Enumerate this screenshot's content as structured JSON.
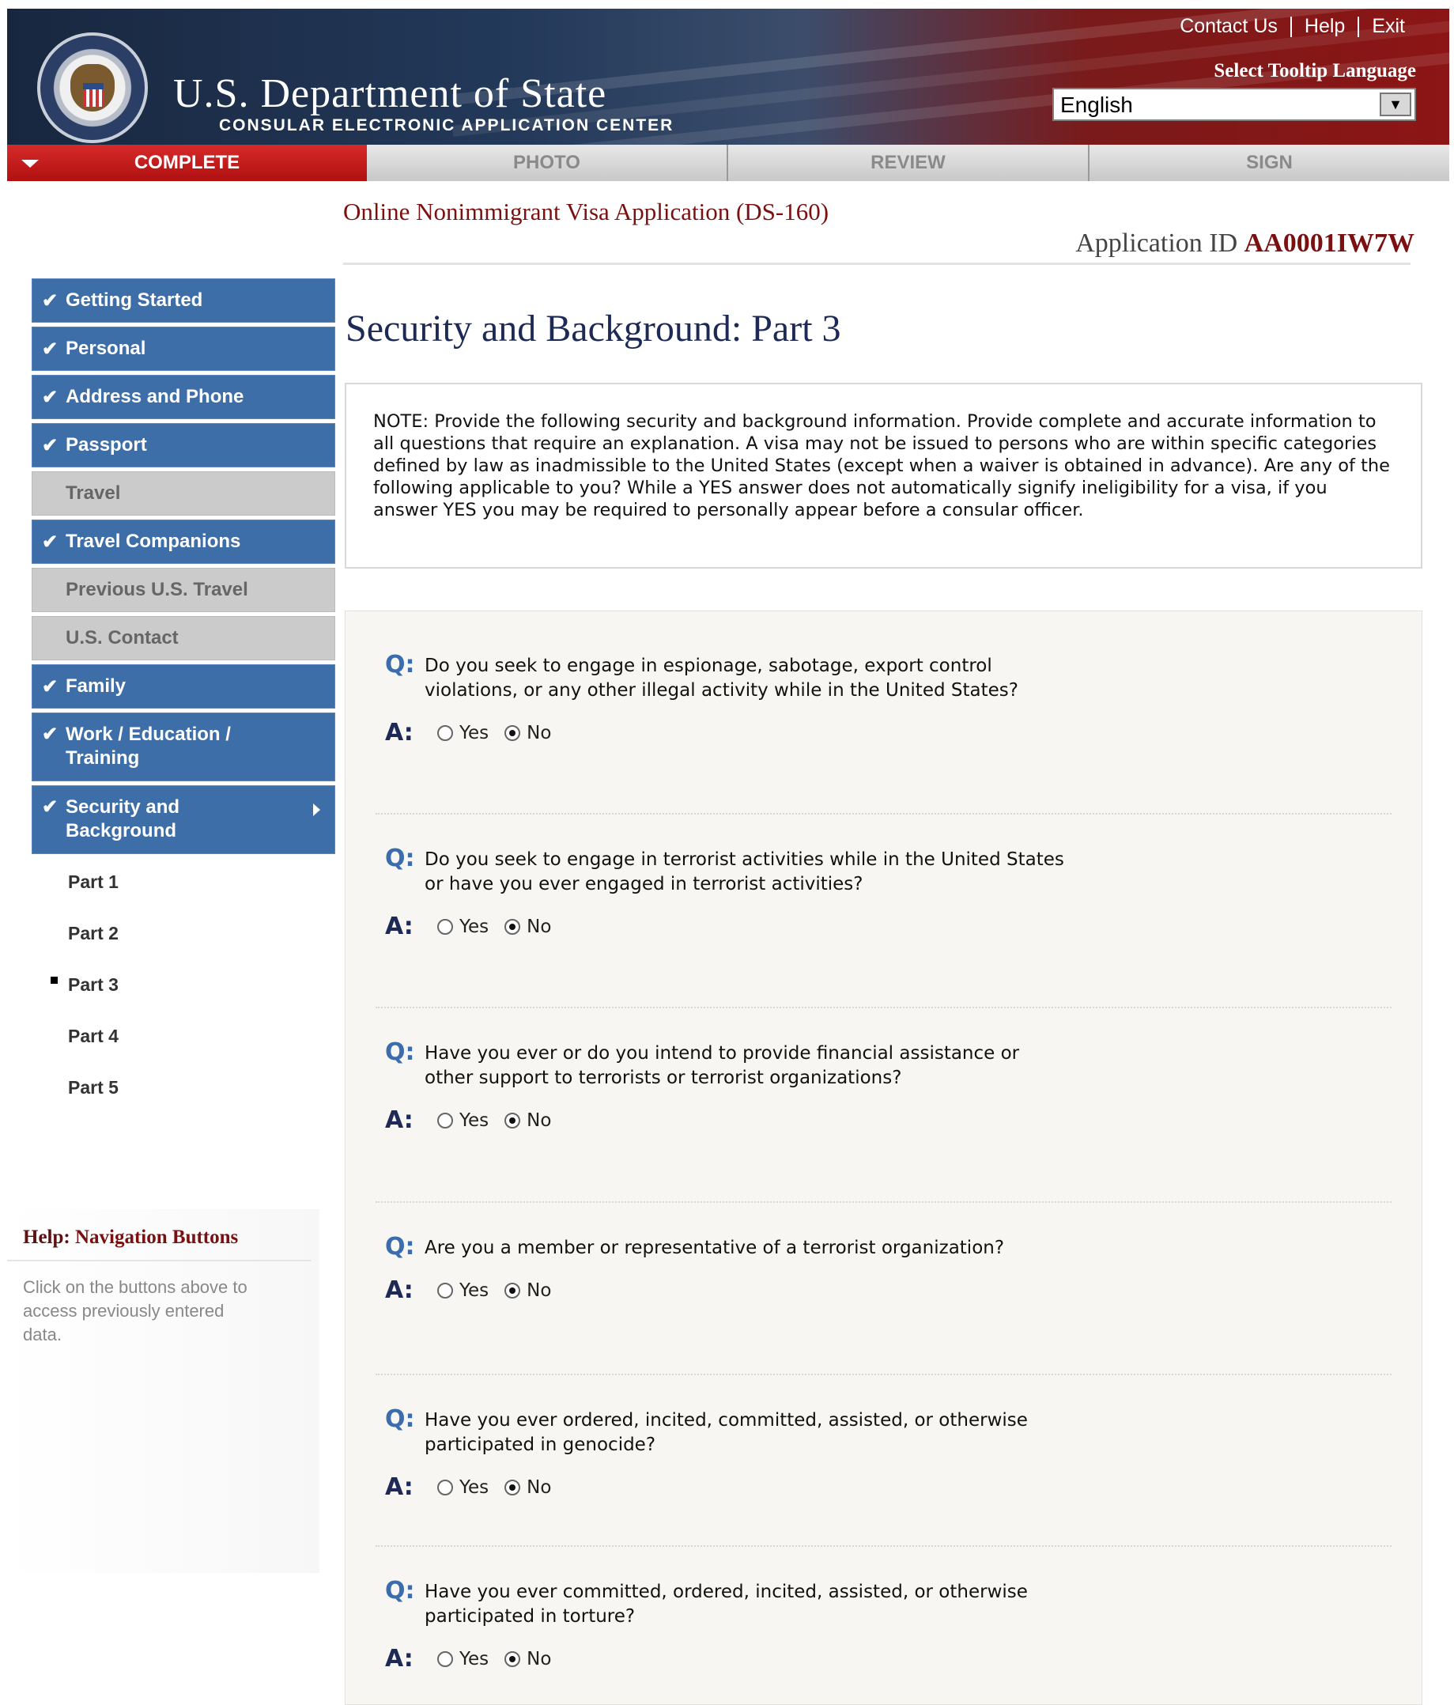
{
  "header": {
    "links": [
      "Contact Us",
      "Help",
      "Exit"
    ],
    "dept_title": "U.S. Department of State",
    "dept_sub": "CONSULAR ELECTRONIC APPLICATION CENTER",
    "tooltip_label": "Select Tooltip Language",
    "tooltip_value": "English"
  },
  "tabs": [
    "COMPLETE",
    "PHOTO",
    "REVIEW",
    "SIGN"
  ],
  "form_title": "Online Nonimmigrant Visa Application (DS-160)",
  "app_id_label": "Application ID",
  "app_id": "AA0001IW7W",
  "sidebar": {
    "items": [
      {
        "label": "Getting Started"
      },
      {
        "label": "Personal"
      },
      {
        "label": "Address and Phone"
      },
      {
        "label": "Passport"
      },
      {
        "label": "Travel"
      },
      {
        "label": "Travel Companions"
      },
      {
        "label": "Previous U.S. Travel"
      },
      {
        "label": "U.S. Contact"
      },
      {
        "label": "Family"
      },
      {
        "label": "Work / Education / Training"
      },
      {
        "label": "Security and Background"
      }
    ],
    "sub_items": [
      "Part 1",
      "Part 2",
      "Part 3",
      "Part 4",
      "Part 5"
    ]
  },
  "help": {
    "title_prefix": "Help:",
    "title": "Navigation Buttons",
    "text": "Click on the buttons above to access previously entered data."
  },
  "main_title": "Security and Background: Part 3",
  "note": "NOTE: Provide the following security and background information. Provide complete and accurate information to all questions that require an explanation. A visa may not be issued to persons who are within specific categories defined by law as inadmissible to the United States (except when a waiver is obtained in advance). Are any of the following applicable to you? While a YES answer does not automatically signify ineligibility for a visa, if you answer YES you may be required to personally appear before a consular officer.",
  "q_label": "Q:",
  "a_label": "A:",
  "yes_label": "Yes",
  "no_label": "No",
  "questions": [
    {
      "text": "Do you seek to engage in espionage, sabotage, export control violations, or any other illegal activity while in the United States?",
      "answer": "No"
    },
    {
      "text": "Do you seek to engage in terrorist activities while in the United States or have you ever engaged in terrorist activities?",
      "answer": "No"
    },
    {
      "text": "Have you ever or do you intend to provide financial assistance or other support to terrorists or terrorist organizations?",
      "answer": "No"
    },
    {
      "text": "Are you a member or representative of a terrorist organization?",
      "answer": "No"
    },
    {
      "text": "Have you ever ordered, incited, committed, assisted, or otherwise participated in genocide?",
      "answer": "No"
    },
    {
      "text": "Have you ever committed, ordered, incited, assisted, or otherwise participated in torture?",
      "answer": "No"
    }
  ]
}
